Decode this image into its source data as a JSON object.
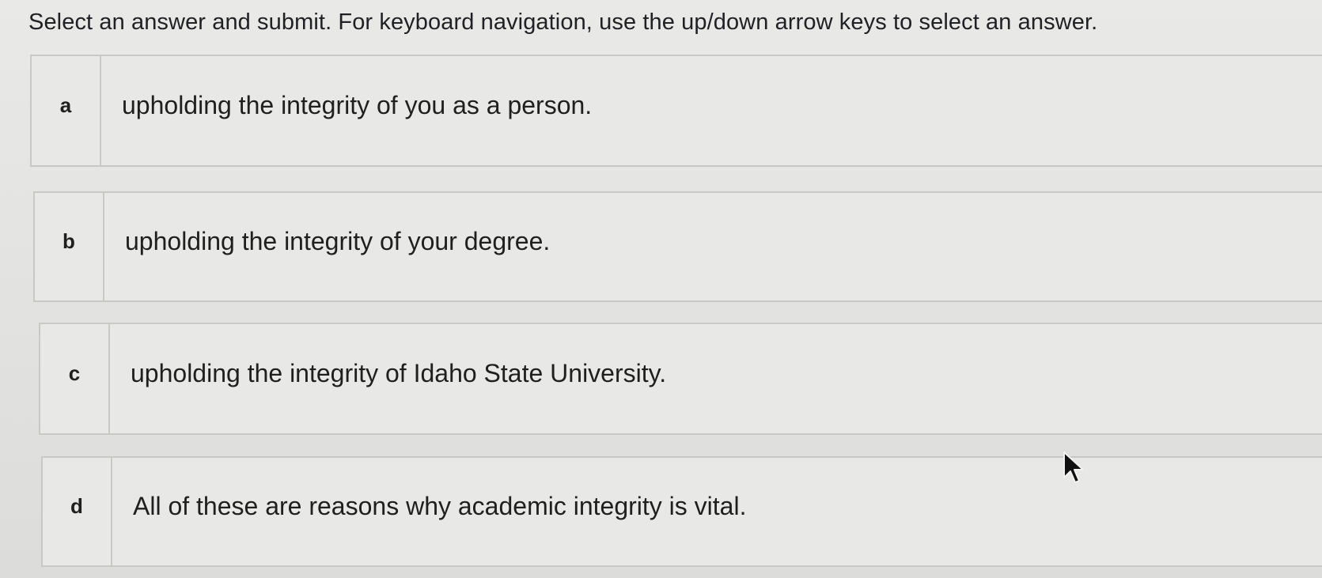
{
  "instructions": "Select an answer and submit. For keyboard navigation, use the up/down arrow keys to select an answer.",
  "options": [
    {
      "letter": "a",
      "text": "upholding the integrity of you as a person."
    },
    {
      "letter": "b",
      "text": "upholding the integrity of your degree."
    },
    {
      "letter": "c",
      "text": "upholding the integrity of Idaho State University."
    },
    {
      "letter": "d",
      "text": "All of these are reasons why academic integrity is vital."
    }
  ],
  "icons": {
    "cursor": "mouse-pointer-icon"
  }
}
